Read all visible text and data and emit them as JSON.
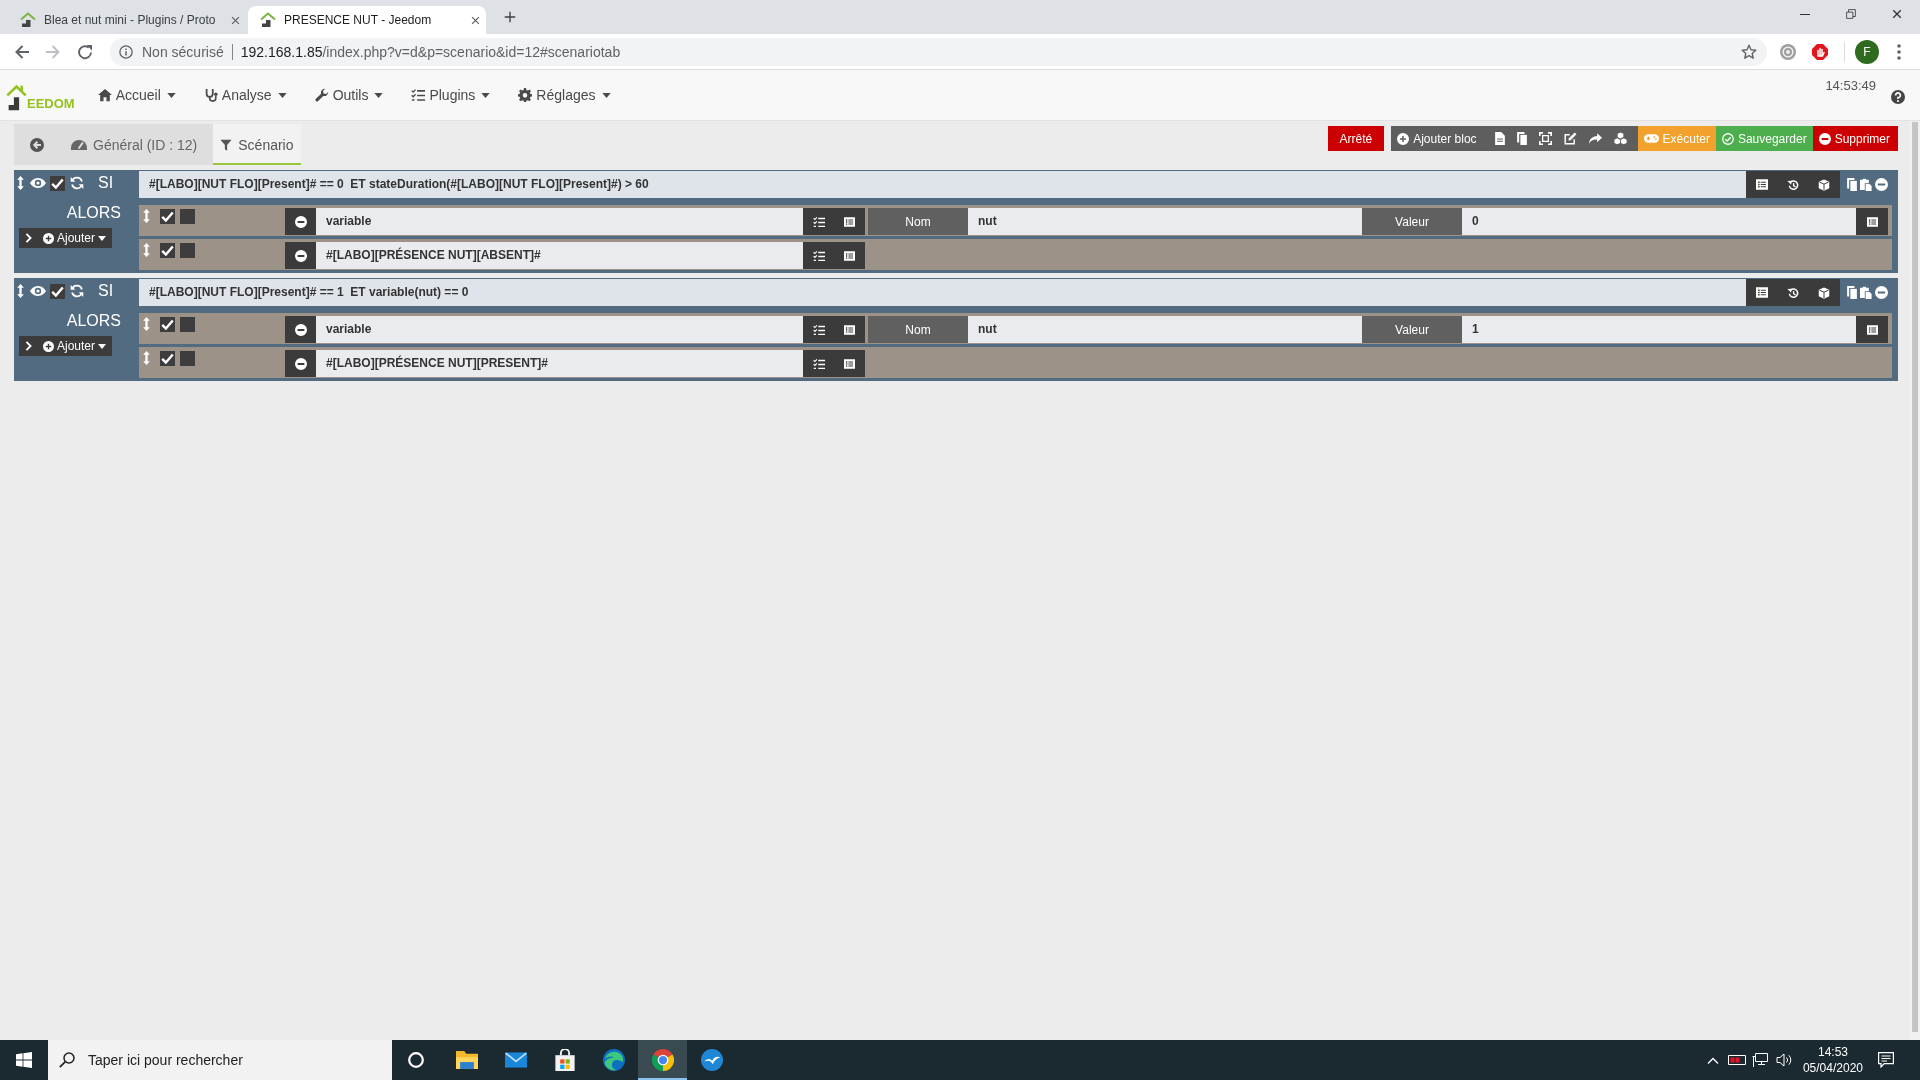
{
  "browser": {
    "tabs": [
      {
        "title": "Blea et nut mini - Plugins / Proto",
        "selected": false
      },
      {
        "title": "PRESENCE NUT - Jeedom",
        "selected": true
      }
    ],
    "address_bar": {
      "security_label": "Non sécurisé",
      "host": "192.168.1.85",
      "path": "/index.php?v=d&p=scenario&id=12#scenariotab"
    },
    "profile_initial": "F"
  },
  "navbar": {
    "logo_text": "EEDOM",
    "menus": [
      "Accueil",
      "Analyse",
      "Outils",
      "Plugins",
      "Réglages"
    ],
    "clock": "14:53:49"
  },
  "scenario": {
    "tabs": [
      {
        "label": "Général (ID : 12)",
        "selected": false
      },
      {
        "label": "Scénario",
        "selected": true
      }
    ],
    "status": "Arrêté",
    "add_block": "Ajouter bloc",
    "execute": "Exécuter",
    "save": "Sauvegarder",
    "delete": "Supprimer",
    "blocks": [
      {
        "keyword": "SI",
        "enabled": true,
        "condition": "#[LABO][NUT FLO][Present]# == 0  ET stateDuration(#[LABO][NUT FLO][Present]#) > 60",
        "then_label": "ALORS",
        "add_label": "Ajouter",
        "actions": [
          {
            "kind": "variable",
            "enabled": true,
            "parallel": false,
            "command": "variable",
            "name_label": "Nom",
            "name": "nut",
            "value_label": "Valeur",
            "value": "0"
          },
          {
            "kind": "command",
            "enabled": true,
            "parallel": false,
            "command": "#[LABO][PRÉSENCE NUT][ABSENT]#"
          }
        ]
      },
      {
        "keyword": "SI",
        "enabled": true,
        "condition": "#[LABO][NUT FLO][Present]# == 1  ET variable(nut) == 0",
        "then_label": "ALORS",
        "add_label": "Ajouter",
        "actions": [
          {
            "kind": "variable",
            "enabled": true,
            "parallel": false,
            "command": "variable",
            "name_label": "Nom",
            "name": "nut",
            "value_label": "Valeur",
            "value": "1"
          },
          {
            "kind": "command",
            "enabled": true,
            "parallel": false,
            "command": "#[LABO][PRÉSENCE NUT][PRESENT]#"
          }
        ]
      }
    ]
  },
  "taskbar": {
    "search": {
      "placeholder": "Taper ici pour rechercher"
    },
    "apps": [
      {
        "selected": false
      },
      {
        "selected": false
      },
      {
        "selected": false
      },
      {
        "selected": false
      },
      {
        "selected": true
      },
      {
        "selected": false
      }
    ],
    "time": "14:53",
    "date": "05/04/2020"
  }
}
